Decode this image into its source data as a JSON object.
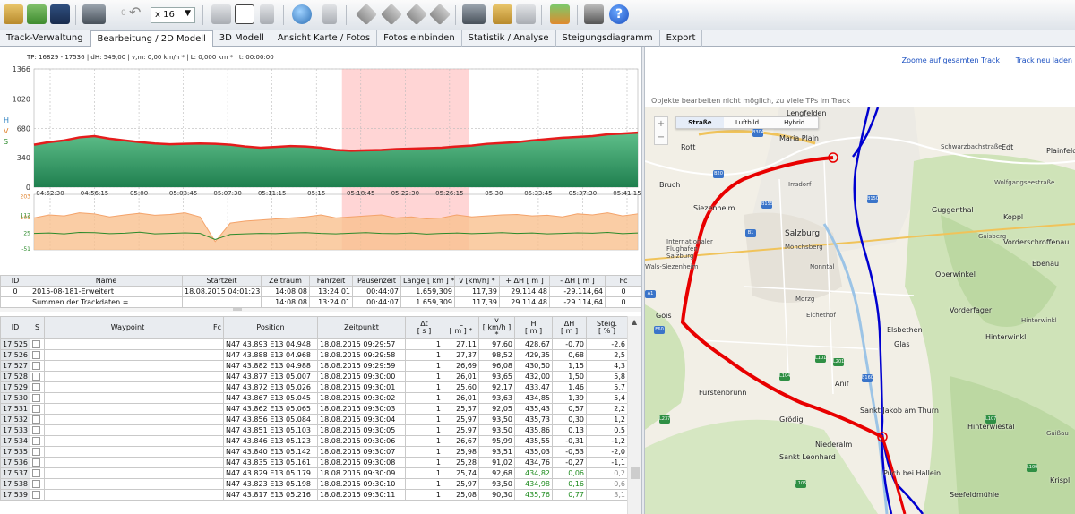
{
  "toolbar": {
    "zoom_value": "x 16",
    "zoom_arrow": "▼",
    "undo_label": "0",
    "help_label": "?"
  },
  "tabs": [
    {
      "label": "Track-Verwaltung"
    },
    {
      "label": "Bearbeitung / 2D Modell"
    },
    {
      "label": "3D Modell"
    },
    {
      "label": "Ansicht Karte / Fotos"
    },
    {
      "label": "Fotos einbinden"
    },
    {
      "label": "Statistik / Analyse"
    },
    {
      "label": "Steigungsdiagramm"
    },
    {
      "label": "Export"
    }
  ],
  "status_line": "TP: 16829 - 17536 | dH: 549,00  | v,m: 0,00 km/h * | L: 0,000 km * | t: 00:00:00",
  "chart_data": {
    "type": "area",
    "panels": [
      {
        "name": "elevation",
        "ylabel": "H\nV\nS",
        "yticks": [
          0,
          340,
          680,
          1020,
          1366
        ],
        "ylim": [
          0,
          1366
        ],
        "xticks": [
          "04:52:30",
          "04:56:15",
          "05:00",
          "05:03:45",
          "05:07:30",
          "05:11:15",
          "05:15",
          "05:18:45",
          "05:22:30",
          "05:26:15",
          "05:30",
          "05:33:45",
          "05:37:30",
          "05:41:15"
        ],
        "series": [
          {
            "name": "H",
            "color": "#e51c1c",
            "values": [
              490,
              520,
              540,
              575,
              590,
              560,
              540,
              520,
              505,
              495,
              500,
              505,
              500,
              490,
              470,
              455,
              465,
              475,
              470,
              455,
              430,
              420,
              425,
              430,
              440,
              445,
              450,
              455,
              470,
              480,
              500,
              510,
              520,
              540,
              555,
              570,
              580,
              590,
              610,
              620,
              630
            ]
          }
        ],
        "highlight": [
          0.51,
          0.72
        ]
      },
      {
        "name": "speed",
        "yticks": [
          -51,
          25,
          101,
          112,
          203
        ],
        "series": [
          {
            "name": "V",
            "color": "#f4a36a",
            "values": [
              95,
              110,
              105,
              120,
              115,
              100,
              110,
              118,
              108,
              112,
              120,
              100,
              -20,
              70,
              80,
              85,
              90,
              95,
              100,
              110,
              95,
              100,
              105,
              110,
              95,
              100,
              90,
              95,
              110,
              100,
              105,
              110,
              112,
              105,
              108,
              100,
              115,
              110,
              120,
              105,
              115
            ]
          },
          {
            "name": "S",
            "color": "#2b8a2b",
            "values": [
              20,
              22,
              18,
              25,
              24,
              19,
              21,
              26,
              18,
              20,
              23,
              20,
              -10,
              15,
              18,
              20,
              19,
              22,
              24,
              20,
              18,
              21,
              24,
              20,
              19,
              22,
              17,
              20,
              22,
              19,
              21,
              24,
              20,
              22,
              18,
              20,
              23,
              21,
              25,
              19,
              22
            ]
          }
        ]
      }
    ]
  },
  "track_table": {
    "headers": [
      "ID",
      "Name",
      "Startzeit",
      "Zeitraum",
      "Fahrzeit",
      "Pausenzeit",
      "Länge  [ km ] *",
      "v  [km/h] *",
      "+ ΔH  [ m ]",
      "- ΔH  [ m ]",
      "Fc"
    ],
    "rows": [
      [
        "0",
        "2015-08-181-Erweitert",
        "18.08.2015 04:01:23",
        "14:08:08",
        "13:24:01",
        "00:44:07",
        "1.659,309",
        "117,39",
        "29.114,48",
        "-29.114,64",
        "0"
      ],
      [
        "",
        "Summen der Trackdaten =",
        "",
        "14:08:08",
        "13:24:01",
        "00:44:07",
        "1.659,309",
        "117,39",
        "29.114,48",
        "-29.114,64",
        "0"
      ]
    ]
  },
  "waypoint_table": {
    "headers": [
      "ID",
      "S",
      "Waypoint",
      "Fc",
      "Position",
      "Zeitpunkt",
      "Δt\n[ s ]",
      "L\n[ m ] *",
      "v\n[ km/h ] *",
      "H\n[ m ]",
      "ΔH\n[ m ]",
      "Steig.\n[ % ]"
    ],
    "rows": [
      [
        "17.525",
        "",
        "",
        "",
        "N47 43.893 E13 04.948",
        "18.08.2015 09:29:57",
        "1",
        "27,11",
        "97,60",
        "428,67",
        "-0,70",
        "-2,6"
      ],
      [
        "17.526",
        "",
        "",
        "",
        "N47 43.888 E13 04.968",
        "18.08.2015 09:29:58",
        "1",
        "27,37",
        "98,52",
        "429,35",
        "0,68",
        "2,5"
      ],
      [
        "17.527",
        "",
        "",
        "",
        "N47 43.882 E13 04.988",
        "18.08.2015 09:29:59",
        "1",
        "26,69",
        "96,08",
        "430,50",
        "1,15",
        "4,3"
      ],
      [
        "17.528",
        "",
        "",
        "",
        "N47 43.877 E13 05.007",
        "18.08.2015 09:30:00",
        "1",
        "26,01",
        "93,65",
        "432,00",
        "1,50",
        "5,8"
      ],
      [
        "17.529",
        "",
        "",
        "",
        "N47 43.872 E13 05.026",
        "18.08.2015 09:30:01",
        "1",
        "25,60",
        "92,17",
        "433,47",
        "1,46",
        "5,7"
      ],
      [
        "17.530",
        "",
        "",
        "",
        "N47 43.867 E13 05.045",
        "18.08.2015 09:30:02",
        "1",
        "26,01",
        "93,63",
        "434,85",
        "1,39",
        "5,4"
      ],
      [
        "17.531",
        "",
        "",
        "",
        "N47 43.862 E13 05.065",
        "18.08.2015 09:30:03",
        "1",
        "25,57",
        "92,05",
        "435,43",
        "0,57",
        "2,2"
      ],
      [
        "17.532",
        "",
        "",
        "",
        "N47 43.856 E13 05.084",
        "18.08.2015 09:30:04",
        "1",
        "25,97",
        "93,50",
        "435,73",
        "0,30",
        "1,2"
      ],
      [
        "17.533",
        "",
        "",
        "",
        "N47 43.851 E13 05.103",
        "18.08.2015 09:30:05",
        "1",
        "25,97",
        "93,50",
        "435,86",
        "0,13",
        "0,5"
      ],
      [
        "17.534",
        "",
        "",
        "",
        "N47 43.846 E13 05.123",
        "18.08.2015 09:30:06",
        "1",
        "26,67",
        "95,99",
        "435,55",
        "-0,31",
        "-1,2"
      ],
      [
        "17.535",
        "",
        "",
        "",
        "N47 43.840 E13 05.142",
        "18.08.2015 09:30:07",
        "1",
        "25,98",
        "93,51",
        "435,03",
        "-0,53",
        "-2,0"
      ],
      [
        "17.536",
        "",
        "",
        "",
        "N47 43.835 E13 05.161",
        "18.08.2015 09:30:08",
        "1",
        "25,28",
        "91,02",
        "434,76",
        "-0,27",
        "-1,1"
      ],
      [
        "17.537",
        "",
        "",
        "",
        "N47 43.829 E13 05.179",
        "18.08.2015 09:30:09",
        "1",
        "25,74",
        "92,68",
        "434,82",
        "0,06",
        "0,2"
      ],
      [
        "17.538",
        "",
        "",
        "",
        "N47 43.823 E13 05.198",
        "18.08.2015 09:30:10",
        "1",
        "25,97",
        "93,50",
        "434,98",
        "0,16",
        "0,6"
      ],
      [
        "17.539",
        "",
        "",
        "",
        "N47 43.817 E13 05.216",
        "18.08.2015 09:30:11",
        "1",
        "25,08",
        "90,30",
        "435,76",
        "0,77",
        "3,1"
      ]
    ],
    "green_from_row": 12
  },
  "map": {
    "zoom_all_link": "Zoome auf gesamten Track",
    "reload_link": "Track neu laden",
    "message": "Objekte bearbeiten nicht möglich, zu viele TPs im Track",
    "types": [
      "Straße",
      "Luftbild",
      "Hybrid"
    ],
    "zoom_in": "+",
    "zoom_out": "−",
    "places": [
      {
        "name": "Lengfelden"
      },
      {
        "name": "Rott"
      },
      {
        "name": "Maria Plain"
      },
      {
        "name": "Bruch"
      },
      {
        "name": "Edt"
      },
      {
        "name": "Plainfeld"
      },
      {
        "name": "Guggenthal"
      },
      {
        "name": "Siezenheim"
      },
      {
        "name": "Koppl"
      },
      {
        "name": "Salzburg"
      },
      {
        "name": "Vorderschroffenau"
      },
      {
        "name": "Ebenau"
      },
      {
        "name": "Oberwinkel"
      },
      {
        "name": "Gois"
      },
      {
        "name": "Vorderfager"
      },
      {
        "name": "Hinterwinkl"
      },
      {
        "name": "Elsbethen"
      },
      {
        "name": "Glas"
      },
      {
        "name": "Fürstenbrunn"
      },
      {
        "name": "Anif"
      },
      {
        "name": "Sankt Jakob am Thurn"
      },
      {
        "name": "Grödig"
      },
      {
        "name": "Hinterwiestal"
      },
      {
        "name": "Niederalm"
      },
      {
        "name": "Sankt Leonhard"
      },
      {
        "name": "Puch bei Hallein"
      },
      {
        "name": "Seefeldmühle"
      },
      {
        "name": "Krispl"
      }
    ],
    "minor_labels": [
      "Wals-Siezenheim",
      "Internationaler Flughafen Salzburg",
      "Mönchsberg",
      "Gaisberg",
      "Hinterwinkl",
      "Gaißau",
      "Wolfgangseestraße",
      "Schwarzbachstraße",
      "Irrsdorf",
      "Morzg",
      "Eichethof",
      "Nonntal"
    ],
    "shields": [
      "B304",
      "B20",
      "B155",
      "B150",
      "B1",
      "L101",
      "L104",
      "L201",
      "B160",
      "L107",
      "L109",
      "L237",
      "L105",
      "A1",
      "E60"
    ],
    "track_colors": {
      "red": "#e80000",
      "blue": "#0000d0"
    }
  }
}
